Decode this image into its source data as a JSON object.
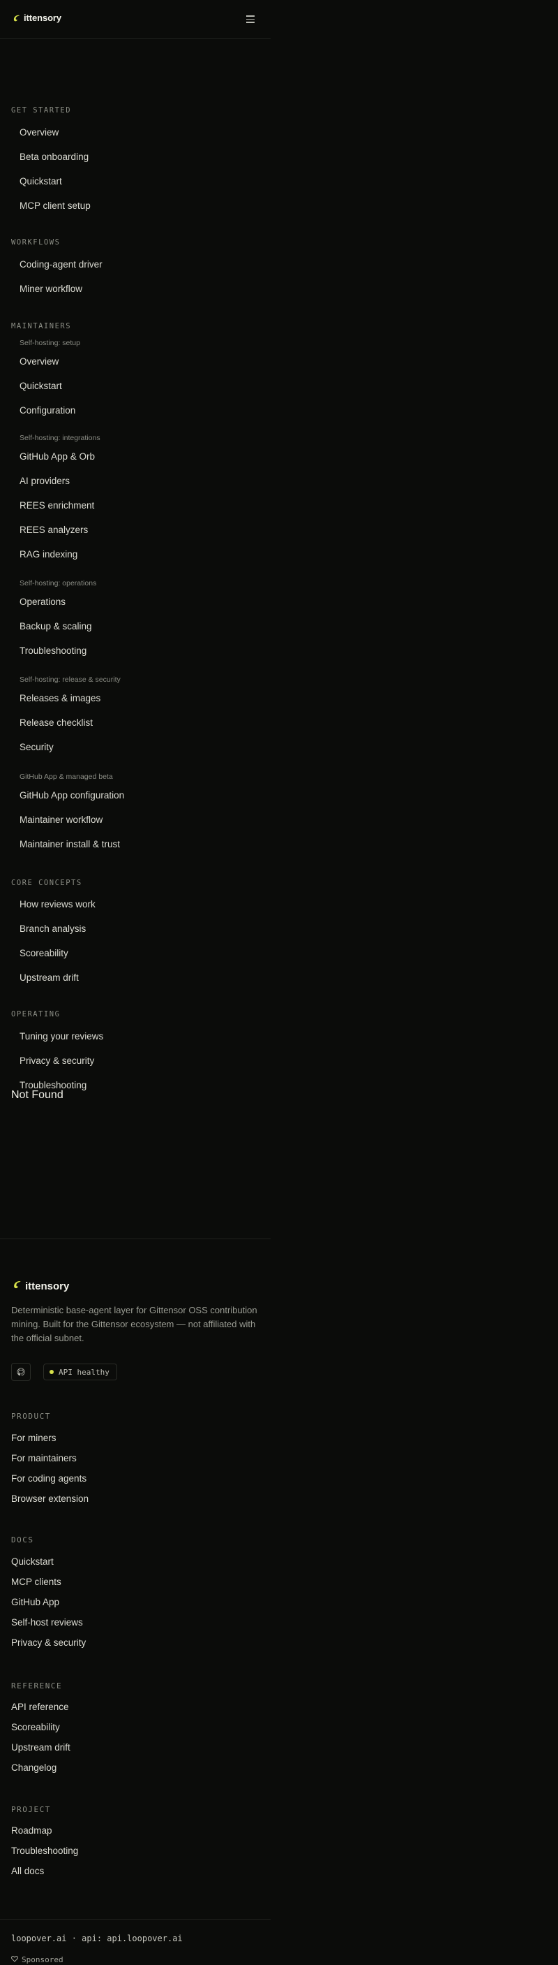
{
  "header": {
    "brand": "ittensory",
    "menu_icon": "hamburger-menu-icon"
  },
  "nav": {
    "get_started": {
      "title": "GET STARTED",
      "items": [
        "Overview",
        "Beta onboarding",
        "Quickstart",
        "MCP client setup"
      ]
    },
    "workflows": {
      "title": "WORKFLOWS",
      "items": [
        "Coding-agent driver",
        "Miner workflow"
      ]
    },
    "maintainers": {
      "title": "MAINTAINERS",
      "groups": [
        {
          "label": "Self-hosting: setup",
          "items": [
            "Overview",
            "Quickstart",
            "Configuration"
          ]
        },
        {
          "label": "Self-hosting: integrations",
          "items": [
            "GitHub App & Orb",
            "AI providers",
            "REES enrichment",
            "REES analyzers",
            "RAG indexing"
          ]
        },
        {
          "label": "Self-hosting: operations",
          "items": [
            "Operations",
            "Backup & scaling",
            "Troubleshooting"
          ]
        },
        {
          "label": "Self-hosting: release & security",
          "items": [
            "Releases & images",
            "Release checklist",
            "Security"
          ]
        },
        {
          "label": "GitHub App & managed beta",
          "items": [
            "GitHub App configuration",
            "Maintainer workflow",
            "Maintainer install & trust"
          ]
        }
      ]
    },
    "core_concepts": {
      "title": "CORE CONCEPTS",
      "items": [
        "How reviews work",
        "Branch analysis",
        "Scoreability",
        "Upstream drift"
      ]
    },
    "operating": {
      "title": "OPERATING",
      "items": [
        "Tuning your reviews",
        "Privacy & security",
        "Troubleshooting"
      ]
    }
  },
  "main": {
    "not_found": "Not Found"
  },
  "footer": {
    "brand": "ittensory",
    "tagline": "Deterministic base-agent layer for Gittensor OSS contribution mining. Built for the Gittensor ecosystem — not affiliated with the official subnet.",
    "github_icon": "github-icon",
    "status": "API healthy",
    "status_color": "#d8e24a",
    "product": {
      "title": "PRODUCT",
      "items": [
        "For miners",
        "For maintainers",
        "For coding agents",
        "Browser extension"
      ]
    },
    "docs": {
      "title": "DOCS",
      "items": [
        "Quickstart",
        "MCP clients",
        "GitHub App",
        "Self-host reviews",
        "Privacy & security"
      ]
    },
    "reference": {
      "title": "REFERENCE",
      "items": [
        "API reference",
        "Scoreability",
        "Upstream drift",
        "Changelog"
      ]
    },
    "project": {
      "title": "PROJECT",
      "items": [
        "Roadmap",
        "Troubleshooting",
        "All docs"
      ]
    },
    "domain_line": "loopover.ai · api: api.loopover.ai",
    "sponsor": "Sponsored"
  },
  "colors": {
    "background": "#0b0c0a",
    "accent": "#d8e24a"
  }
}
